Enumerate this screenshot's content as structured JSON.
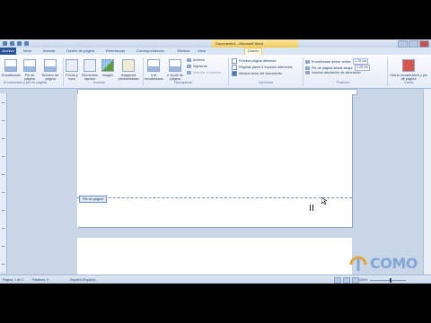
{
  "title_bar": {
    "context_tab": "Herramientas para encabezado y pie de página",
    "title": "Documento1 - Microsoft Word"
  },
  "tabs": [
    "Archivo",
    "Inicio",
    "Insertar",
    "Diseño de página",
    "Referencias",
    "Correspondencia",
    "Revisar",
    "Vista",
    "Diseño"
  ],
  "ribbon": {
    "hf_group": {
      "header": "Encabezado",
      "footer": "Pie de página",
      "page_number": "Número de página",
      "label": "Encabezado y pie de página"
    },
    "insert_group": {
      "date_time": "Fecha y hora",
      "quick_parts": "Elementos rápidos",
      "picture": "Imagen",
      "clipart": "Imágenes prediseñadas",
      "label": "Insertar"
    },
    "nav_group": {
      "goto_header": "Ir al encabezado",
      "goto_footer": "Ir al pie de página",
      "previous": "Anterior",
      "next": "Siguiente",
      "link_previous": "Vincular al anterior",
      "label": "Navegación"
    },
    "options_group": {
      "different_first": "Primera página diferente",
      "odd_even": "Páginas pares e impares diferentes",
      "show_text": "Mostrar texto del documento",
      "label": "Opciones"
    },
    "position_group": {
      "header_from_top": "Encabezado desde arriba:",
      "footer_from_bottom": "Pie de página desde abajo:",
      "insert_tab": "Insertar tabulación de alineación",
      "top_value": "1,25 cm",
      "bottom_value": "1,25 cm",
      "label": "Posición"
    },
    "close_group": {
      "close": "Cerrar encabezado y pie de página",
      "label": "Cerrar"
    }
  },
  "document": {
    "footer_label": "Pie de página"
  },
  "status_bar": {
    "page": "Página: 1 de 2",
    "words": "Palabras: 0",
    "language": "Español (España)",
    "zoom": "100%"
  },
  "watermark": {
    "brand": "COMO"
  }
}
